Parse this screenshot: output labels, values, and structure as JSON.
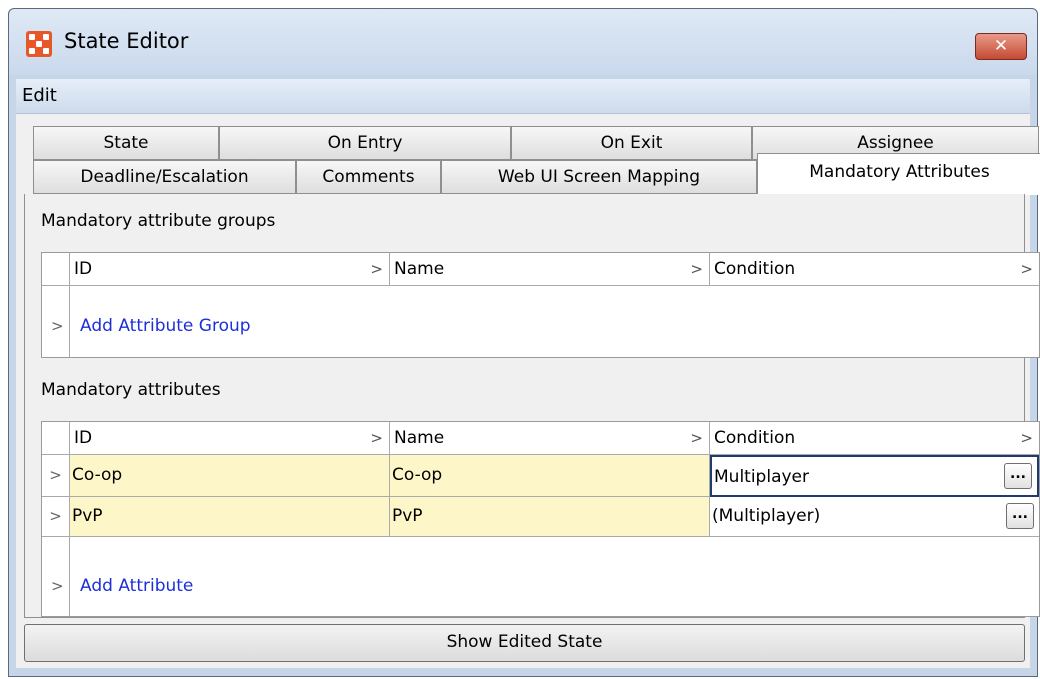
{
  "window": {
    "title": "State Editor",
    "close_label": "✕"
  },
  "menu": {
    "items": [
      "Edit"
    ]
  },
  "tabs": {
    "row1": [
      "State",
      "On Entry",
      "On Exit",
      "Assignee"
    ],
    "row2": [
      "Deadline/Escalation",
      "Comments",
      "Web UI Screen Mapping",
      "Mandatory Attributes"
    ],
    "active": "Mandatory Attributes"
  },
  "groups_section": {
    "label": "Mandatory attribute groups",
    "columns": [
      "ID",
      "Name",
      "Condition"
    ],
    "add_label": "Add Attribute Group"
  },
  "attributes_section": {
    "label": "Mandatory attributes",
    "columns": [
      "ID",
      "Name",
      "Condition"
    ],
    "rows": [
      {
        "id": "Co-op",
        "name": "Co-op",
        "condition": "Multiplayer"
      },
      {
        "id": "PvP",
        "name": "PvP",
        "condition": "(Multiplayer)"
      }
    ],
    "ellipsis_label": "...",
    "add_label": "Add Attribute"
  },
  "footer": {
    "show_button_label": "Show Edited State"
  },
  "glyphs": {
    "chevron": ">"
  },
  "colors": {
    "title_bg": "#c9d9ec",
    "close_red": "#c54a33",
    "link_blue": "#1d2fd8",
    "cell_yellow": "#fdf6c9"
  }
}
